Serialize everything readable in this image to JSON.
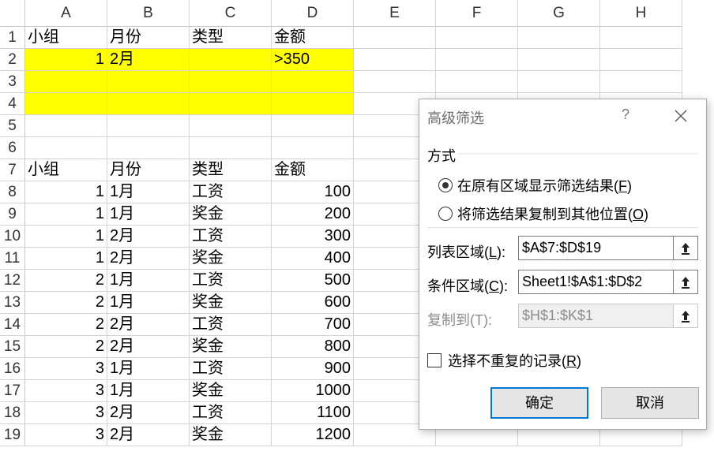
{
  "columns": [
    "A",
    "B",
    "C",
    "D",
    "E",
    "F",
    "G",
    "H"
  ],
  "rows": [
    {
      "num": "1",
      "cells": [
        "小组",
        "月份",
        "类型",
        "金额"
      ]
    },
    {
      "num": "2",
      "cells": [
        "1",
        "2月",
        "",
        ">350"
      ]
    },
    {
      "num": "3",
      "cells": [
        "",
        "",
        "",
        ""
      ]
    },
    {
      "num": "4",
      "cells": [
        "",
        "",
        "",
        ""
      ]
    },
    {
      "num": "5",
      "cells": [
        "",
        "",
        "",
        ""
      ]
    },
    {
      "num": "6",
      "cells": [
        "",
        "",
        "",
        ""
      ]
    },
    {
      "num": "7",
      "cells": [
        "小组",
        "月份",
        "类型",
        "金额"
      ]
    },
    {
      "num": "8",
      "cells": [
        "1",
        "1月",
        "工资",
        "100"
      ]
    },
    {
      "num": "9",
      "cells": [
        "1",
        "1月",
        "奖金",
        "200"
      ]
    },
    {
      "num": "10",
      "cells": [
        "1",
        "2月",
        "工资",
        "300"
      ]
    },
    {
      "num": "11",
      "cells": [
        "1",
        "2月",
        "奖金",
        "400"
      ]
    },
    {
      "num": "12",
      "cells": [
        "2",
        "1月",
        "工资",
        "500"
      ]
    },
    {
      "num": "13",
      "cells": [
        "2",
        "1月",
        "奖金",
        "600"
      ]
    },
    {
      "num": "14",
      "cells": [
        "2",
        "2月",
        "工资",
        "700"
      ]
    },
    {
      "num": "15",
      "cells": [
        "2",
        "2月",
        "奖金",
        "800"
      ]
    },
    {
      "num": "16",
      "cells": [
        "3",
        "1月",
        "工资",
        "900"
      ]
    },
    {
      "num": "17",
      "cells": [
        "3",
        "1月",
        "奖金",
        "1000"
      ]
    },
    {
      "num": "18",
      "cells": [
        "3",
        "2月",
        "工资",
        "1100"
      ]
    },
    {
      "num": "19",
      "cells": [
        "3",
        "2月",
        "奖金",
        "1200"
      ]
    }
  ],
  "highlight_color": "#ffff00",
  "dialog": {
    "title": "高级筛选",
    "help": "?",
    "section_label": "方式",
    "option_in_place": {
      "text": "在原有区域显示筛选结果(",
      "key": "F",
      "tail": ")",
      "checked": true
    },
    "option_copy": {
      "text": "将筛选结果复制到其他位置(",
      "key": "O",
      "tail": ")",
      "checked": false
    },
    "list_range": {
      "label": "列表区域(",
      "key": "L",
      "tail": "):",
      "value": "$A$7:$D$19"
    },
    "criteria_range": {
      "label": "条件区域(",
      "key": "C",
      "tail": "):",
      "value": "Sheet1!$A$1:$D$2"
    },
    "copy_to": {
      "label": "复制到(T):",
      "value": "$H$1:$K$1",
      "disabled": true
    },
    "unique_records": {
      "text": "选择不重复的记录(",
      "key": "R",
      "tail": ")",
      "checked": false
    },
    "ok_label": "确定",
    "cancel_label": "取消",
    "accent_color": "#0078d7"
  }
}
